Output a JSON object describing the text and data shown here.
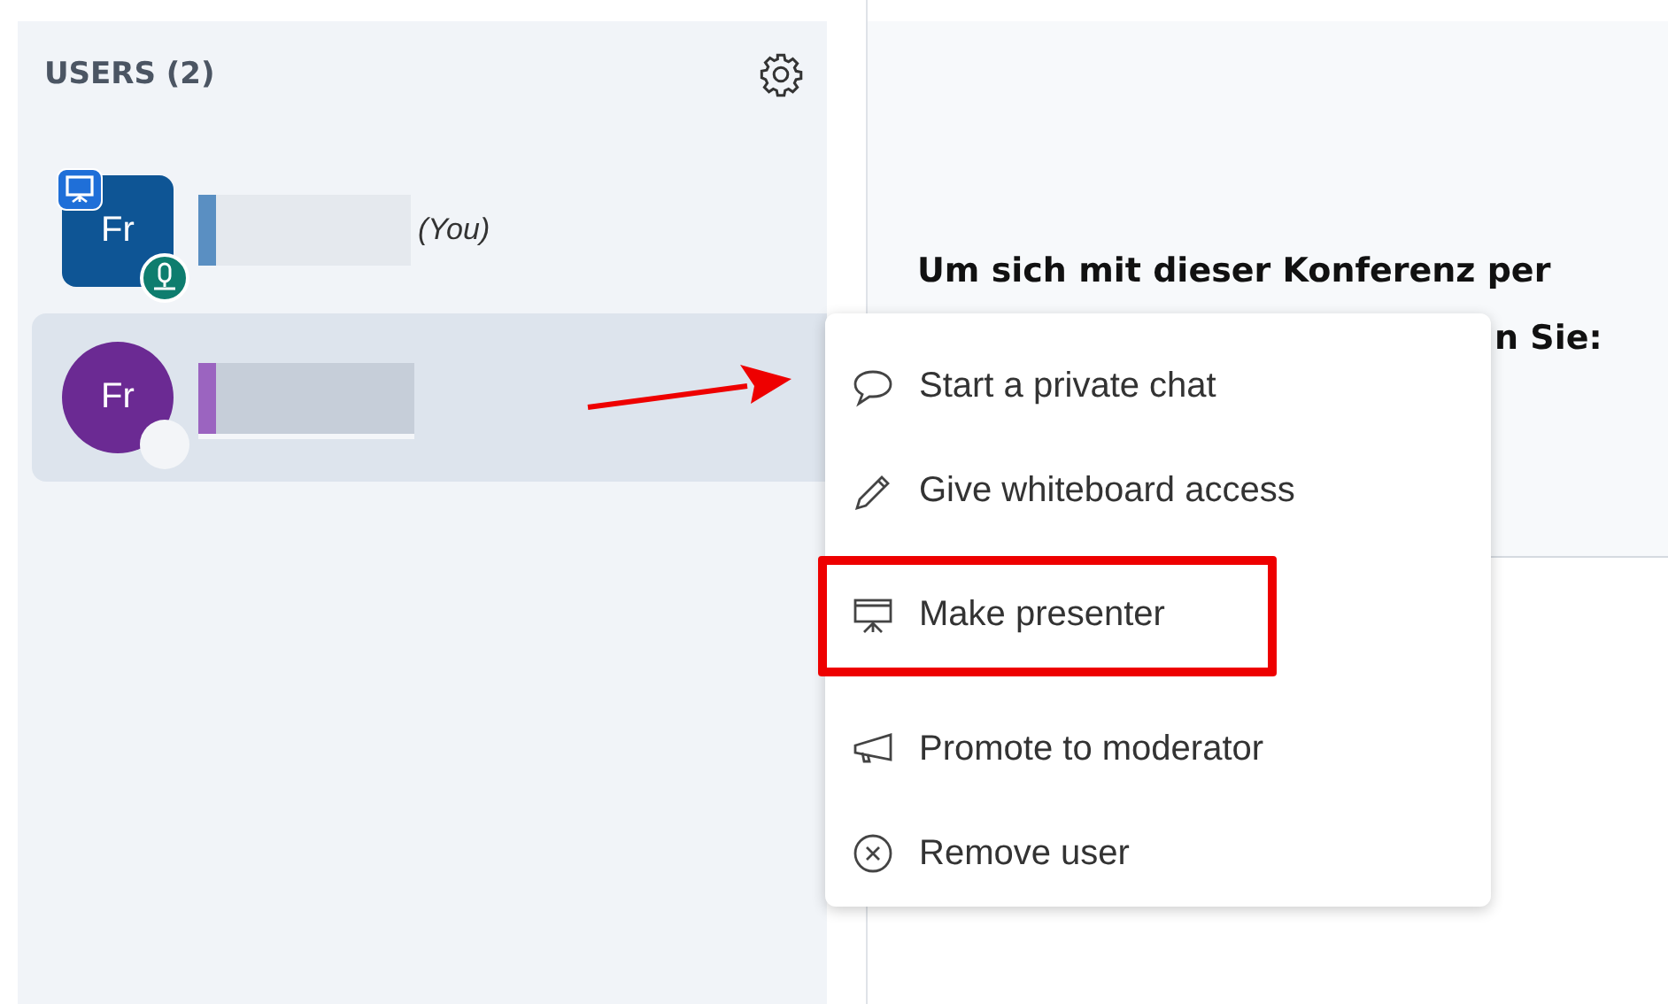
{
  "sidebar": {
    "title": "USERS (2)",
    "users": [
      {
        "initials": "Fr",
        "kind": "moderator",
        "color": "#0e5595",
        "presenter": true,
        "microphone": true,
        "you_label": "(You)",
        "selected": false
      },
      {
        "initials": "Fr",
        "kind": "viewer",
        "color": "#6b2a93",
        "presenter": false,
        "microphone": false,
        "selected": true
      }
    ]
  },
  "main": {
    "lines": [
      "Um sich mit dieser Konferenz per",
      "n Sie:"
    ]
  },
  "context_menu": {
    "pointer_arrow": true,
    "items": [
      {
        "label": "Start a private chat",
        "highlighted": false
      },
      {
        "label": "Give whiteboard access",
        "highlighted": false
      },
      {
        "label": "Make presenter",
        "highlighted": true
      },
      {
        "label": "Promote to moderator",
        "highlighted": false
      },
      {
        "label": "Remove user",
        "highlighted": false
      }
    ]
  }
}
